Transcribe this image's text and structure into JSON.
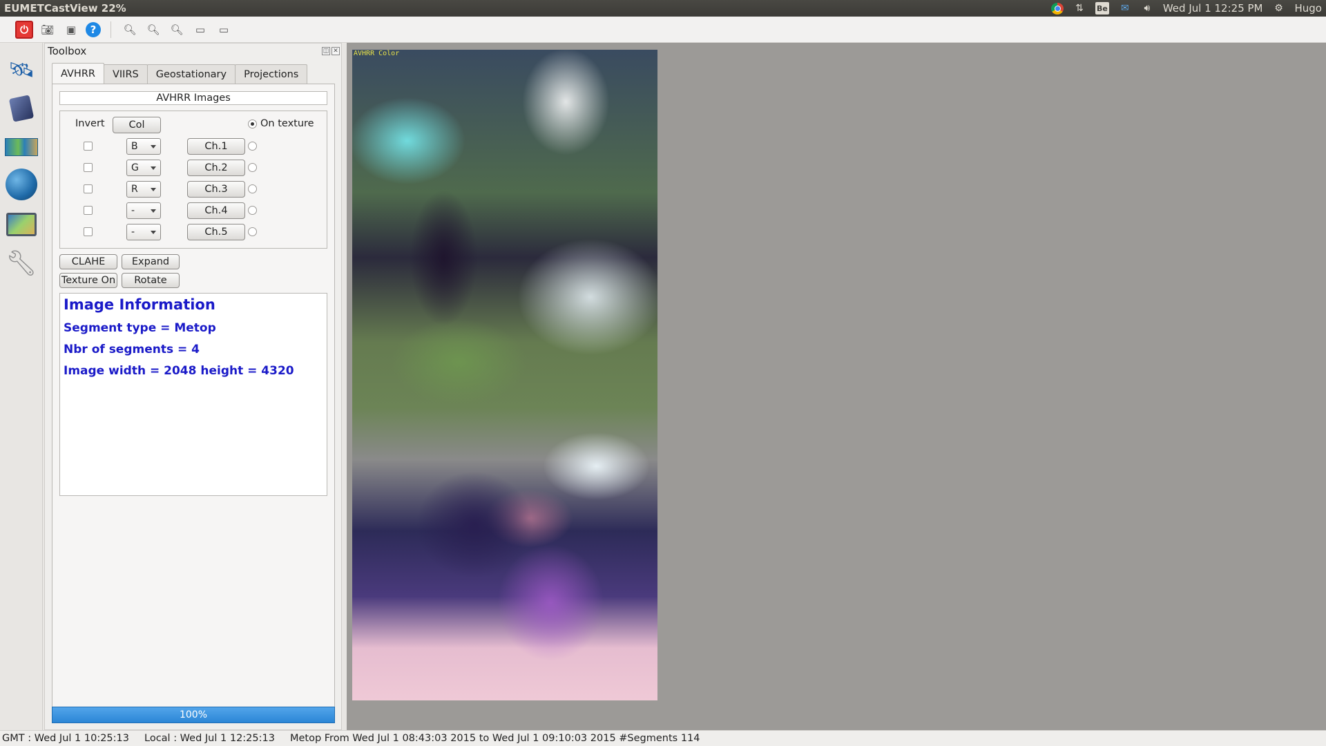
{
  "app": {
    "title": "EUMETCastView 22%"
  },
  "panel": {
    "indicators": [
      "chrome",
      "network",
      "Be",
      "mail",
      "volume"
    ],
    "datetime": "Wed Jul  1 12:25 PM",
    "user": "Hugo"
  },
  "toolbar": {
    "buttons": [
      "power",
      "camera",
      "camera-lens",
      "help",
      "zoom-out",
      "zoom-in",
      "zoom-reset",
      "pan-left",
      "pan-right"
    ]
  },
  "toolbox": {
    "title": "Toolbox",
    "tabs": [
      "AVHRR",
      "VIIRS",
      "Geostationary",
      "Projections"
    ],
    "active_tab": "AVHRR",
    "images_title": "AVHRR Images",
    "invert_label": "Invert",
    "col_button": "Col",
    "on_texture_label": "On texture",
    "channels": [
      {
        "color": "B",
        "label": "Ch.1"
      },
      {
        "color": "G",
        "label": "Ch.2"
      },
      {
        "color": "R",
        "label": "Ch.3"
      },
      {
        "color": "-",
        "label": "Ch.4"
      },
      {
        "color": "-",
        "label": "Ch.5"
      }
    ],
    "actions": {
      "clahe": "CLAHE",
      "expand": "Expand",
      "texture": "Texture On",
      "rotate": "Rotate"
    },
    "info": {
      "heading": "Image Information",
      "lines": [
        "Segment type = Metop",
        "Nbr of segments = 4",
        "Image width = 2048 height = 4320"
      ]
    },
    "progress": {
      "value": 1.0,
      "label": "100%"
    }
  },
  "viewer": {
    "overlay_label": "AVHRR Color"
  },
  "status": {
    "gmt": "GMT : Wed Jul  1 10:25:13",
    "local": "Local : Wed Jul  1 12:25:13",
    "range": "Metop From Wed Jul 1 08:43:03 2015 to Wed Jul 1 09:10:03 2015  #Segments 114"
  }
}
